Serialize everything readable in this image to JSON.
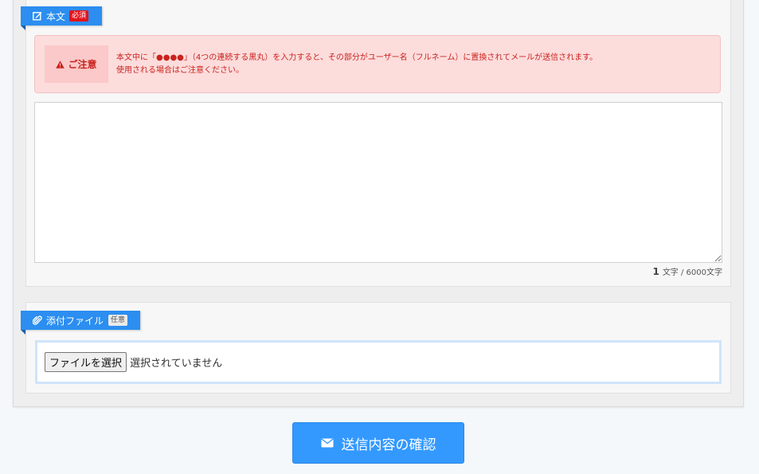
{
  "body_section": {
    "label": "本文",
    "required_badge": "必須",
    "icon": "edit-icon"
  },
  "notice": {
    "label": "ご注意",
    "icon": "warning-icon",
    "line1": "本文中に「●●●●」（4つの連続する黒丸）を入力すると、その部分がユーザー名（フルネーム）に置換されてメールが送信されます。",
    "line2": "使用される場合はご注意ください。"
  },
  "body_input": {
    "value": ""
  },
  "counter": {
    "count": "1",
    "text": "文字 / 6000文字"
  },
  "attachment_section": {
    "label": "添付ファイル",
    "optional_badge": "任意",
    "icon": "paperclip-icon"
  },
  "file_input": {
    "button_label": "ファイルを選択",
    "status": "選択されていません"
  },
  "submit": {
    "label": "送信内容の確認",
    "icon": "mail-icon"
  },
  "colors": {
    "accent": "#2b8ef0",
    "notice_bg": "#fddcdc",
    "notice_text": "#c9231d",
    "required": "#e4141b",
    "submit_bg": "#3399ff"
  }
}
